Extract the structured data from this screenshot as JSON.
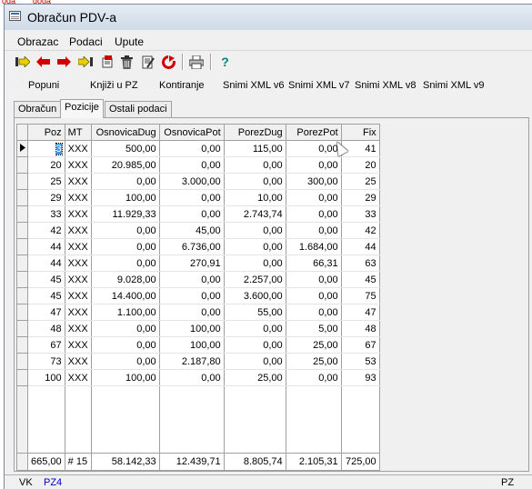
{
  "background_fragments": [
    "oda",
    "doga"
  ],
  "window": {
    "title": "Obračun PDV-a"
  },
  "menu": {
    "items": [
      "Obrazac",
      "Podaci",
      "Upute"
    ]
  },
  "toolbar": {
    "icons": [
      "first-record-icon",
      "previous-record-icon",
      "next-record-icon",
      "last-record-icon",
      "new-record-icon",
      "delete-icon",
      "edit-icon",
      "refresh-icon",
      "print-icon",
      "help-icon"
    ],
    "help_glyph": "?"
  },
  "actions": {
    "popuni": "Popuni",
    "knjizi": "Knjiži u PZ",
    "kontiranje": "Kontiranje",
    "xml_v6": "Snimi XML v6",
    "xml_v7": "Snimi XML v7",
    "xml_v8": "Snimi XML v8",
    "xml_v9": "Snimi XML v9"
  },
  "tabs": [
    {
      "label": "Obračun",
      "active": false
    },
    {
      "label": "Pozicije",
      "active": true
    },
    {
      "label": "Ostali podaci",
      "active": false
    }
  ],
  "grid": {
    "columns": [
      "Poz",
      "MT",
      "OsnovicaDug",
      "OsnovicaPot",
      "PorezDug",
      "PorezPot",
      "Fix"
    ],
    "rows": [
      [
        "3",
        "XXX",
        "500,00",
        "0,00",
        "115,00",
        "0,00",
        "41"
      ],
      [
        "20",
        "XXX",
        "20.985,00",
        "0,00",
        "0,00",
        "0,00",
        "20"
      ],
      [
        "25",
        "XXX",
        "0,00",
        "3.000,00",
        "0,00",
        "300,00",
        "25"
      ],
      [
        "29",
        "XXX",
        "100,00",
        "0,00",
        "10,00",
        "0,00",
        "29"
      ],
      [
        "33",
        "XXX",
        "11.929,33",
        "0,00",
        "2.743,74",
        "0,00",
        "33"
      ],
      [
        "42",
        "XXX",
        "0,00",
        "45,00",
        "0,00",
        "0,00",
        "42"
      ],
      [
        "44",
        "XXX",
        "0,00",
        "6.736,00",
        "0,00",
        "1.684,00",
        "44"
      ],
      [
        "44",
        "XXX",
        "0,00",
        "270,91",
        "0,00",
        "66,31",
        "63"
      ],
      [
        "45",
        "XXX",
        "9.028,00",
        "0,00",
        "2.257,00",
        "0,00",
        "45"
      ],
      [
        "45",
        "XXX",
        "14.400,00",
        "0,00",
        "3.600,00",
        "0,00",
        "75"
      ],
      [
        "47",
        "XXX",
        "1.100,00",
        "0,00",
        "55,00",
        "0,00",
        "47"
      ],
      [
        "48",
        "XXX",
        "0,00",
        "100,00",
        "0,00",
        "5,00",
        "48"
      ],
      [
        "67",
        "XXX",
        "0,00",
        "100,00",
        "0,00",
        "25,00",
        "67"
      ],
      [
        "73",
        "XXX",
        "0,00",
        "2.187,80",
        "0,00",
        "25,00",
        "53"
      ],
      [
        "100",
        "XXX",
        "100,00",
        "0,00",
        "25,00",
        "0,00",
        "93"
      ]
    ],
    "selected_row": 0,
    "footer": [
      "665,00",
      "# 15",
      "58.142,33",
      "12.439,71",
      "8.805,74",
      "2.105,31",
      "725,00"
    ]
  },
  "status": {
    "left1": "VK",
    "left2": "PZ4",
    "right": "PZ"
  },
  "colors": {
    "selection": "#3399ff",
    "status_link": "#0000c0",
    "toolbar_red": "#d00000"
  }
}
